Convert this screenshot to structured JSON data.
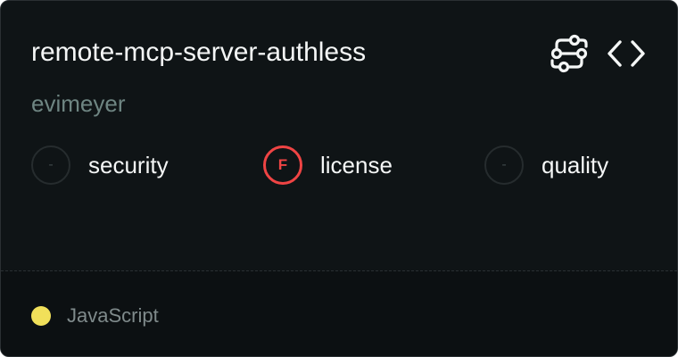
{
  "server": {
    "name": "remote-mcp-server-authless",
    "author": "evimeyer"
  },
  "header_icons": [
    {
      "icon": "workflow-icon"
    },
    {
      "icon": "code-brackets-icon"
    }
  ],
  "scores": [
    {
      "label": "security",
      "grade": "-",
      "status": "none"
    },
    {
      "label": "license",
      "grade": "F",
      "status": "fail",
      "color": "#ef4444"
    },
    {
      "label": "quality",
      "grade": "-",
      "status": "none"
    }
  ],
  "language": {
    "name": "JavaScript",
    "color": "#f1e05a"
  }
}
